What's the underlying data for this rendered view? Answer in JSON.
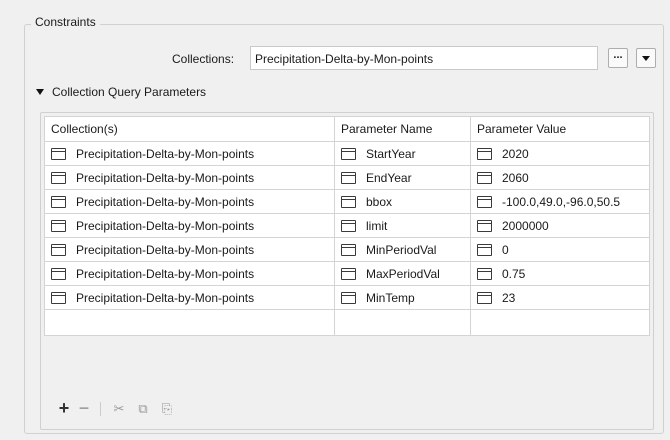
{
  "constraints": {
    "title": "Constraints",
    "collections_label": "Collections:",
    "collections_value": "Precipitation-Delta-by-Mon-points",
    "browse_label": "...",
    "dropdown_icon": "chevron-down-icon"
  },
  "section": {
    "title": "Collection Query Parameters",
    "expanded": true
  },
  "table": {
    "headers": [
      "Collection(s)",
      "Parameter Name",
      "Parameter Value"
    ],
    "rows": [
      {
        "collection": "Precipitation-Delta-by-Mon-points",
        "name": "StartYear",
        "value": "2020"
      },
      {
        "collection": "Precipitation-Delta-by-Mon-points",
        "name": "EndYear",
        "value": "2060"
      },
      {
        "collection": "Precipitation-Delta-by-Mon-points",
        "name": "bbox",
        "value": "-100.0,49.0,-96.0,50.5"
      },
      {
        "collection": "Precipitation-Delta-by-Mon-points",
        "name": "limit",
        "value": "2000000"
      },
      {
        "collection": "Precipitation-Delta-by-Mon-points",
        "name": "MinPeriodVal",
        "value": "0"
      },
      {
        "collection": "Precipitation-Delta-by-Mon-points",
        "name": "MaxPeriodVal",
        "value": "0.75"
      },
      {
        "collection": "Precipitation-Delta-by-Mon-points",
        "name": "MinTemp",
        "value": "23"
      }
    ]
  },
  "toolbar": {
    "add": "+",
    "remove": "−",
    "cut": "✂",
    "copy": "⧉",
    "paste": "⎘"
  }
}
